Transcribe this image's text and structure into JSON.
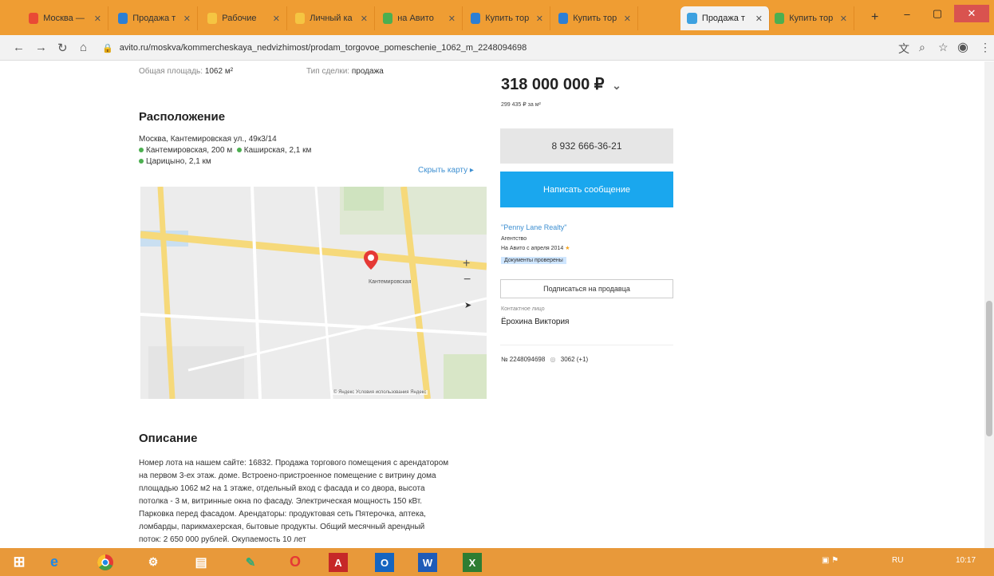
{
  "browser": {
    "tabs": [
      {
        "title": "Москва —",
        "color": "#e94a35"
      },
      {
        "title": "Продажа т",
        "color": "#2d7fd4"
      },
      {
        "title": "Рабочие",
        "color": "#f5c542"
      },
      {
        "title": "Личный ка",
        "color": "#f5c542"
      },
      {
        "title": "на Авито",
        "color": "#4caf50"
      },
      {
        "title": "Купить тор",
        "color": "#2d7fd4"
      },
      {
        "title": "Купить тор",
        "color": "#2d7fd4"
      },
      {
        "title": "Продажа т",
        "color": "#3da1e0",
        "active": true
      },
      {
        "title": "Купить тор",
        "color": "#4caf50"
      }
    ],
    "url": "avito.ru/moskva/kommercheskaya_nedvizhimost/prodam_torgovoe_pomeschenie_1062_m_2248094698",
    "new_tab": "+",
    "win_min": "–",
    "win_max": "▢",
    "win_close": "✕"
  },
  "listing": {
    "area_label": "Общая площадь:",
    "area_value": "1062 м²",
    "deal_label": "Тип сделки:",
    "deal_value": "продажа",
    "location_heading": "Расположение",
    "address": "Москва, Кантемировская ул., 49к3/14",
    "metro1": "Кантемировская, 200 м",
    "metro2": "Каширская, 2,1 км",
    "metro3": "Царицыно, 2,1 км",
    "show_map": "Скрыть карту ▸",
    "map_place": "Кантемировская",
    "map_credit": "© Яндекс  Условия использования  Яндекс",
    "description_heading": "Описание",
    "description": [
      "Номер лота на нашем сайте: 16832. Продажа торгового помещения с арендатором",
      "на первом 3-ех этаж. доме. Встроено-пристроенное помещение с витрину дома",
      "площадью 1062 м2 на 1 этаже, отдельный вход с фасада и со двора, высота",
      "потолка - 3 м, витринные окна по фасаду. Электрическая мощность 150 кВт.",
      "Парковка перед фасадом. Арендаторы: продуктовая сеть Пятерочка, аптека,",
      "ломбарды, парикмахерская, бытовые продукты. Общий месячный арендный",
      "поток: 2 650 000 рублей. Окупаемость 10 лет"
    ]
  },
  "sidebar": {
    "price": "318 000 000 ₽",
    "price_arrow": "⌄",
    "price_per_m": "299 435 ₽ за м²",
    "phone": "8 932 666-36-21",
    "message_button": "Написать сообщение",
    "seller_name": "\"Penny Lane Realty\"",
    "seller_type": "Агентство",
    "seller_since": "На Авито с апреля 2014",
    "badge": "Документы проверены",
    "subscribe_button": "Подписаться на продавца",
    "contact_label": "Контактное лицо",
    "contact_name": "Ёрохина Виктория",
    "listing_id": "№ 2248094698",
    "views": "3062 (+1)"
  },
  "taskbar": {
    "clock": "10:17",
    "lang": "RU"
  }
}
